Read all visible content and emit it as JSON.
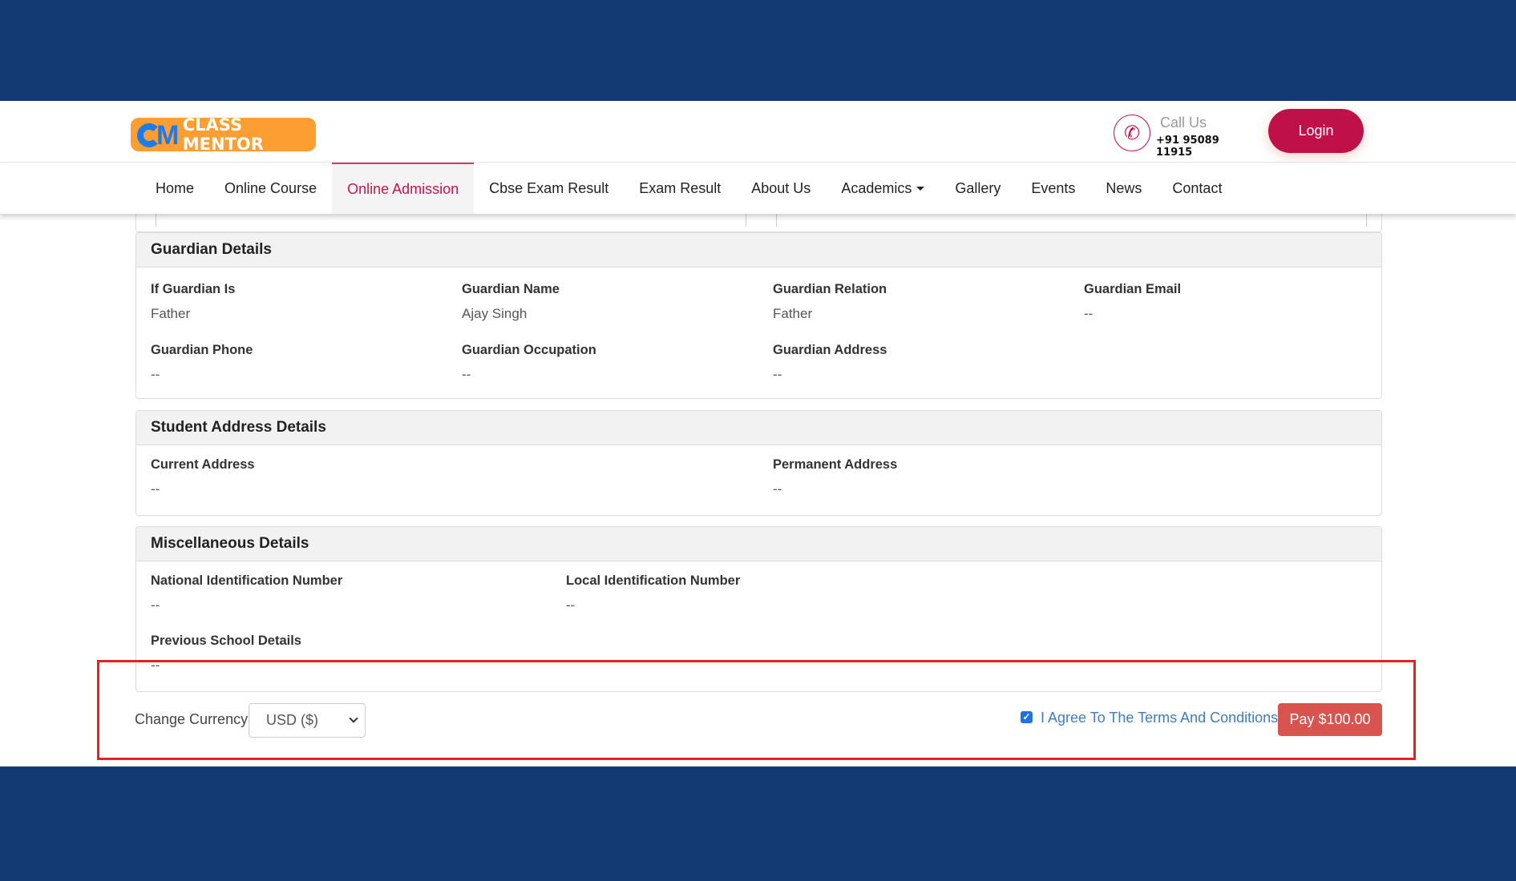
{
  "header": {
    "logo_text": "CLASS MENTOR",
    "logo_mark": "M",
    "call_label": "Call Us",
    "call_number": "+91 95089 11915",
    "login_label": "Login"
  },
  "nav": {
    "items": [
      {
        "label": "Home"
      },
      {
        "label": "Online Course"
      },
      {
        "label": "Online Admission",
        "active": true
      },
      {
        "label": "Cbse Exam Result"
      },
      {
        "label": "Exam Result"
      },
      {
        "label": "About Us"
      },
      {
        "label": "Academics",
        "dropdown": true
      },
      {
        "label": "Gallery"
      },
      {
        "label": "Events"
      },
      {
        "label": "News"
      },
      {
        "label": "Contact"
      }
    ]
  },
  "guardian": {
    "title": "Guardian Details",
    "fields": [
      {
        "label": "If Guardian Is",
        "value": "Father"
      },
      {
        "label": "Guardian Name",
        "value": "Ajay Singh"
      },
      {
        "label": "Guardian Relation",
        "value": "Father"
      },
      {
        "label": "Guardian Email",
        "value": "--"
      },
      {
        "label": "Guardian Phone",
        "value": "--"
      },
      {
        "label": "Guardian Occupation",
        "value": "--"
      },
      {
        "label": "Guardian Address",
        "value": "--"
      }
    ]
  },
  "address": {
    "title": "Student Address Details",
    "fields": [
      {
        "label": "Current Address",
        "value": "--"
      },
      {
        "label": "Permanent Address",
        "value": "--"
      }
    ]
  },
  "misc": {
    "title": "Miscellaneous Details",
    "fields": [
      {
        "label": "National Identification Number",
        "value": "--"
      },
      {
        "label": "Local Identification Number",
        "value": "--"
      },
      {
        "label": "Previous School Details",
        "value": "--"
      }
    ]
  },
  "payment": {
    "currency_label": "Change Currency:",
    "currency_selected": "USD ($)",
    "agree_checked": true,
    "agree_label": "I Agree To The Terms And Conditions",
    "pay_label": "Pay $100.00"
  },
  "colors": {
    "band": "#133a72",
    "brand_primary": "#c0104a",
    "logo_bg": "#fd9e33",
    "pay_button": "#d9534f",
    "link": "#3f7cc0",
    "highlight": "#e52126"
  }
}
